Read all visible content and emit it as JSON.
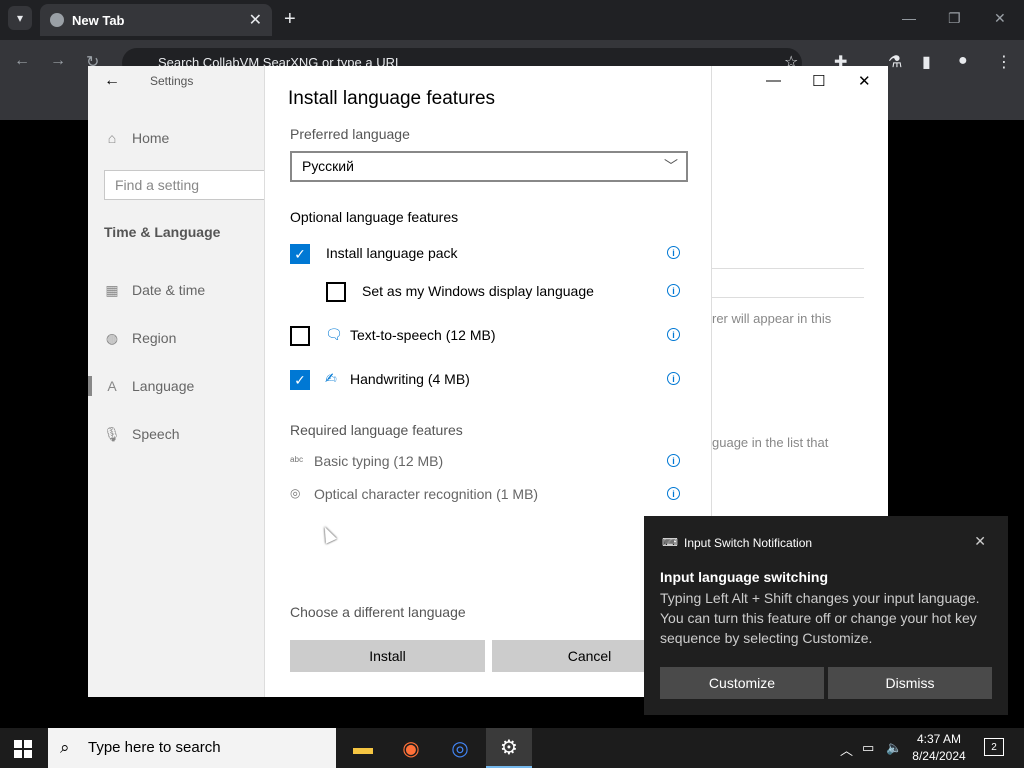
{
  "browser": {
    "tab_title": "New Tab",
    "omnibox_placeholder": "Search CollabVM SearXNG or type a URL"
  },
  "settings": {
    "title": "Settings",
    "home": "Home",
    "search_placeholder": "Find a setting",
    "section": "Time & Language",
    "nav": [
      {
        "label": "Date & time",
        "icon": "calendar-icon"
      },
      {
        "label": "Region",
        "icon": "globe-icon"
      },
      {
        "label": "Language",
        "icon": "language-icon"
      },
      {
        "label": "Speech",
        "icon": "microphone-icon"
      }
    ],
    "right_texts": [
      "rer will appear in this",
      "guage in the list that"
    ]
  },
  "dialog": {
    "title": "Install language features",
    "preferred_label": "Preferred language",
    "preferred_value": "Русский",
    "optional_label": "Optional language features",
    "options": [
      {
        "label": "Install language pack",
        "checked": true
      },
      {
        "label": "Set as my Windows display language",
        "checked": false
      },
      {
        "label": "Text-to-speech (12 MB)",
        "checked": false
      },
      {
        "label": "Handwriting (4 MB)",
        "checked": true
      }
    ],
    "required_label": "Required language features",
    "required": [
      {
        "label": "Basic typing (12 MB)",
        "icon": "abc-icon"
      },
      {
        "label": "Optical character recognition (1 MB)",
        "icon": "ocr-icon"
      }
    ],
    "choose_different": "Choose a different language",
    "install_label": "Install",
    "cancel_label": "Cancel"
  },
  "toast": {
    "app_name": "Input Switch Notification",
    "title": "Input language switching",
    "body": "Typing Left Alt + Shift changes your input language. You can turn this feature off or change your hot key sequence by selecting Customize.",
    "customize_label": "Customize",
    "dismiss_label": "Dismiss"
  },
  "taskbar": {
    "search_placeholder": "Type here to search",
    "time": "4:37 AM",
    "date": "8/24/2024",
    "notification_count": "2"
  },
  "colors": {
    "accent": "#0078d4",
    "toast_bg": "#1f1f1f",
    "taskbar_bg": "#1c1c1c"
  }
}
